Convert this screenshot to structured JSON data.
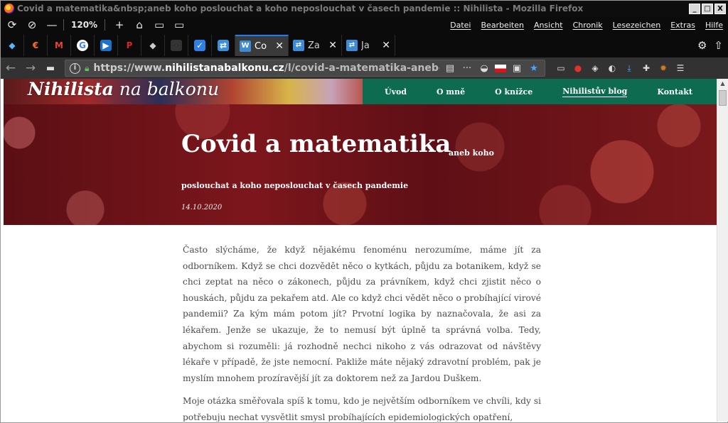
{
  "window": {
    "title": "Covid a matematika&nbsp;aneb koho poslouchat a koho neposlouchat v časech pandemie :: Nihilista - Mozilla Firefox",
    "buttons": [
      "_",
      "□",
      "X"
    ]
  },
  "toolbar": {
    "zoom": "120%",
    "menus": [
      "Datei",
      "Bearbeiten",
      "Ansicht",
      "Chronik",
      "Lesezeichen",
      "Extras",
      "Hilfe"
    ]
  },
  "tabs": [
    {
      "label": "Co",
      "active": true,
      "favicon": "W"
    },
    {
      "label": "Za",
      "active": false,
      "favicon": "⇄"
    },
    {
      "label": "Ja",
      "active": false,
      "favicon": "⇄"
    }
  ],
  "addressbar": {
    "url_prefix": "https://www.",
    "url_host": "nihilistanabalkonu.cz",
    "url_path": "/l/covid-a-matematika-aneb-ko"
  },
  "site": {
    "logo_bold": "Nihilista",
    "logo_rest": " na balkonu",
    "nav": [
      "Úvod",
      "O mně",
      "O knížce",
      "Nihilistův blog",
      "Kontakt"
    ]
  },
  "article": {
    "title": "Covid a matematika",
    "subtitle_part1": "aneb koho",
    "subtitle_part2": "poslouchat a koho neposlouchat v časech pandemie",
    "date": "14.10.2020",
    "paragraphs": [
      "Často slýcháme, že když nějakému fenoménu nerozumíme, máme jít za odborníkem. Když se chci dozvědět něco o kytkách, půjdu za botanikem, když se chci zeptat na něco o zákonech, půjdu za právníkem, když chci zjistit něco o houskách, půjdu za pekařem atd. Ale co když chci vědět něco o probíhající virové pandemii? Za kým mám potom jít? Prvotní logika by naznačovala, že asi za lékařem. Jenže se ukazuje, že to nemusí být úplně ta správná volba. Tedy, abychom si rozuměli: já rozhodně nechci nikoho z vás odrazovat od návštěvy lékaře v případě, že jste nemocní. Pakliže máte nějaký zdravotní problém, pak je myslím mnohem prozíravější jít za doktorem než za Jardou Duškem.",
      "Moje otázka směřovala spíš k tomu, kdo je největším odborníkem ve chvíli, kdy si potřebuju nechat vysvětlit smysl probíhajících epidemiologických opatření,"
    ]
  }
}
